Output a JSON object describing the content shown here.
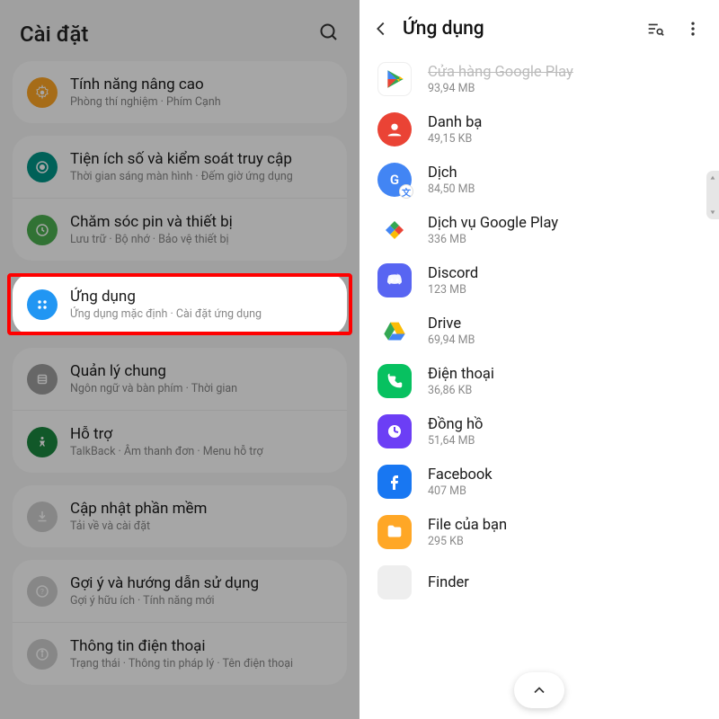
{
  "left": {
    "title": "Cài đặt",
    "groups": [
      [
        {
          "icon": "advanced",
          "title": "Tính năng nâng cao",
          "sub": "Phòng thí nghiệm · Phím Cạnh"
        }
      ],
      [
        {
          "icon": "wellbeing",
          "title": "Tiện ích số và kiểm soát truy cập",
          "sub": "Thời gian sáng màn hình · Đếm giờ ứng dụng"
        },
        {
          "icon": "care",
          "title": "Chăm sóc pin và thiết bị",
          "sub": "Lưu trữ · Bộ nhớ · Bảo vệ thiết bị"
        }
      ]
    ],
    "highlighted": {
      "icon": "apps",
      "title": "Ứng dụng",
      "sub": "Ứng dụng mặc định · Cài đặt ứng dụng"
    },
    "groups2": [
      [
        {
          "icon": "general",
          "title": "Quản lý chung",
          "sub": "Ngôn ngữ và bàn phím · Thời gian"
        },
        {
          "icon": "access",
          "title": "Hỗ trợ",
          "sub": "TalkBack · Âm thanh đơn · Menu hỗ trợ"
        }
      ],
      [
        {
          "icon": "update",
          "title": "Cập nhật phần mềm",
          "sub": "Tải về và cài đặt"
        }
      ],
      [
        {
          "icon": "tips",
          "title": "Gợi ý và hướng dẫn sử dụng",
          "sub": "Gợi ý hữu ích · Tính năng mới"
        },
        {
          "icon": "about",
          "title": "Thông tin điện thoại",
          "sub": "Trạng thái · Thông tin pháp lý · Tên điện thoại"
        }
      ]
    ]
  },
  "right": {
    "title": "Ứng dụng",
    "apps": [
      {
        "icon": "play",
        "name": "Cửa hàng Google Play",
        "size": "93,94 MB",
        "cut": true
      },
      {
        "icon": "contacts",
        "name": "Danh bạ",
        "size": "49,15 KB"
      },
      {
        "icon": "translate",
        "name": "Dịch",
        "size": "84,50 MB"
      },
      {
        "icon": "pservices",
        "name": "Dịch vụ Google Play",
        "size": "336 MB"
      },
      {
        "icon": "discord",
        "name": "Discord",
        "size": "123 MB"
      },
      {
        "icon": "drive",
        "name": "Drive",
        "size": "69,94 MB"
      },
      {
        "icon": "phone",
        "name": "Điện thoại",
        "size": "36,86 KB"
      },
      {
        "icon": "clock",
        "name": "Đồng hồ",
        "size": "51,64 MB"
      },
      {
        "icon": "facebook",
        "name": "Facebook",
        "size": "407 MB"
      },
      {
        "icon": "files",
        "name": "File của bạn",
        "size": "295 KB"
      },
      {
        "icon": "finder",
        "name": "Finder",
        "size": ""
      }
    ]
  }
}
